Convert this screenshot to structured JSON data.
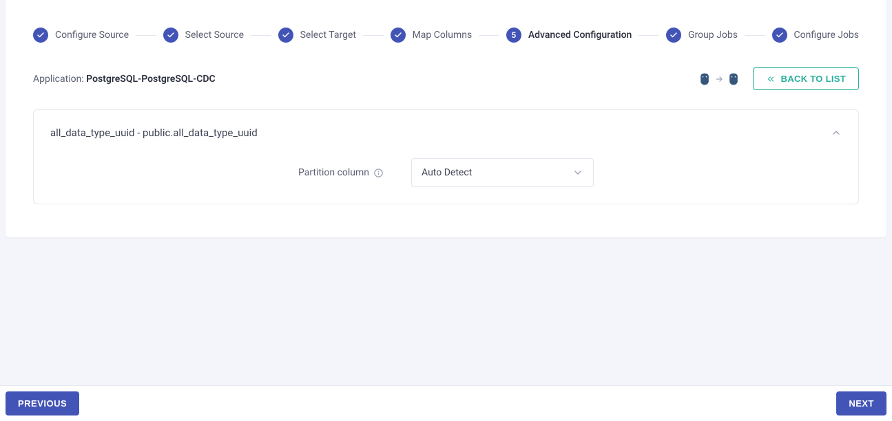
{
  "stepper": {
    "steps": [
      {
        "label": "Configure Source",
        "state": "done"
      },
      {
        "label": "Select Source",
        "state": "done"
      },
      {
        "label": "Select Target",
        "state": "done"
      },
      {
        "label": "Map Columns",
        "state": "done"
      },
      {
        "label": "Advanced Configuration",
        "state": "current",
        "number": "5"
      },
      {
        "label": "Group Jobs",
        "state": "done"
      },
      {
        "label": "Configure Jobs",
        "state": "done"
      }
    ]
  },
  "application": {
    "prefix": "Application: ",
    "name": "PostgreSQL-PostgreSQL-CDC"
  },
  "buttons": {
    "back_to_list": "BACK TO LIST",
    "previous": "PREVIOUS",
    "next": "NEXT"
  },
  "panel": {
    "title": "all_data_type_uuid - public.all_data_type_uuid",
    "partition_label": "Partition column",
    "partition_value": "Auto Detect"
  },
  "db_pair": {
    "source": "postgresql",
    "target": "postgresql"
  }
}
